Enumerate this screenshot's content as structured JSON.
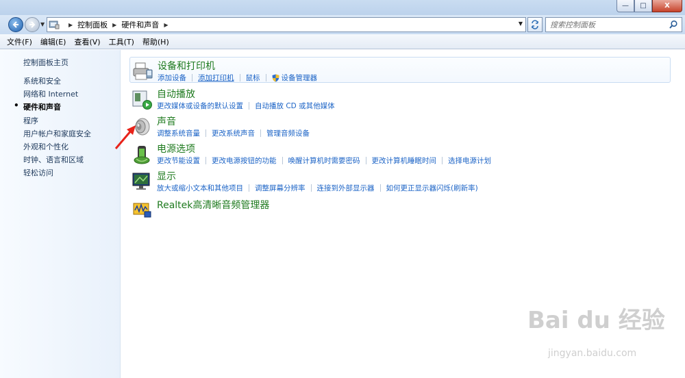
{
  "window": {
    "minimize_label": "—",
    "maximize_label": "□",
    "close_label": "X"
  },
  "address": {
    "crumbs": [
      "控制面板",
      "硬件和声音"
    ],
    "search_placeholder": "搜索控制面板"
  },
  "menu": [
    "文件(F)",
    "编辑(E)",
    "查看(V)",
    "工具(T)",
    "帮助(H)"
  ],
  "sidebar": {
    "home": "控制面板主页",
    "items": [
      {
        "label": "系统和安全",
        "active": false
      },
      {
        "label": "网络和 Internet",
        "active": false
      },
      {
        "label": "硬件和声音",
        "active": true
      },
      {
        "label": "程序",
        "active": false
      },
      {
        "label": "用户帐户和家庭安全",
        "active": false
      },
      {
        "label": "外观和个性化",
        "active": false
      },
      {
        "label": "时钟、语言和区域",
        "active": false
      },
      {
        "label": "轻松访问",
        "active": false
      }
    ]
  },
  "categories": [
    {
      "title": "设备和打印机",
      "icon": "printer-icon",
      "links": [
        "添加设备",
        "添加打印机",
        "鼠标",
        "设备管理器"
      ]
    },
    {
      "title": "自动播放",
      "icon": "autoplay-icon",
      "links": [
        "更改媒体或设备的默认设置",
        "自动播放 CD 或其他媒体"
      ]
    },
    {
      "title": "声音",
      "icon": "speaker-icon",
      "links": [
        "调整系统音量",
        "更改系统声音",
        "管理音频设备"
      ]
    },
    {
      "title": "电源选项",
      "icon": "power-icon",
      "links": [
        "更改节能设置",
        "更改电源按钮的功能",
        "唤醒计算机时需要密码",
        "更改计算机睡眠时间",
        "选择电源计划"
      ]
    },
    {
      "title": "显示",
      "icon": "display-icon",
      "links": [
        "放大或缩小文本和其他项目",
        "调整屏幕分辨率",
        "连接到外部显示器",
        "如何更正显示器闪烁(刷新率)"
      ]
    },
    {
      "title": "Realtek高清晰音频管理器",
      "icon": "realtek-audio-icon",
      "links": []
    }
  ],
  "watermark": {
    "text": "Bai du 经验",
    "url_text": "jingyan.baidu.com"
  },
  "colors": {
    "link": "#1b63c6",
    "title": "#1e7a1e",
    "arrow": "#e8231a"
  }
}
